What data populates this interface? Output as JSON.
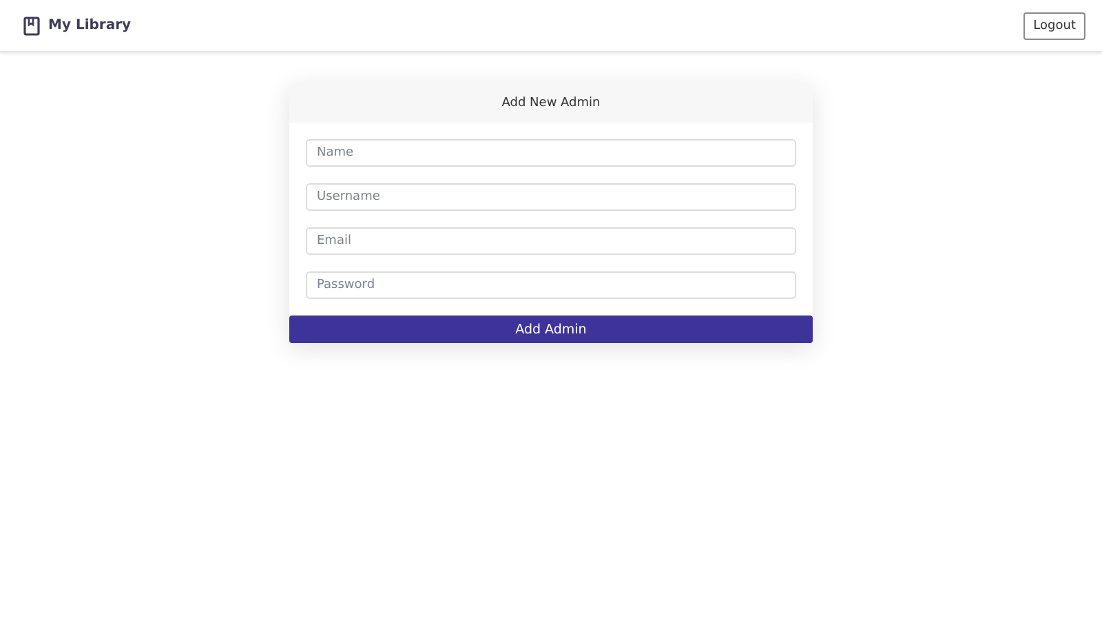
{
  "navbar": {
    "brand": "My Library",
    "logout": "Logout"
  },
  "form": {
    "title": "Add New Admin",
    "fields": [
      {
        "placeholder": "Name"
      },
      {
        "placeholder": "Username"
      },
      {
        "placeholder": "Email"
      },
      {
        "placeholder": "Password"
      }
    ],
    "submit": "Add Admin"
  }
}
